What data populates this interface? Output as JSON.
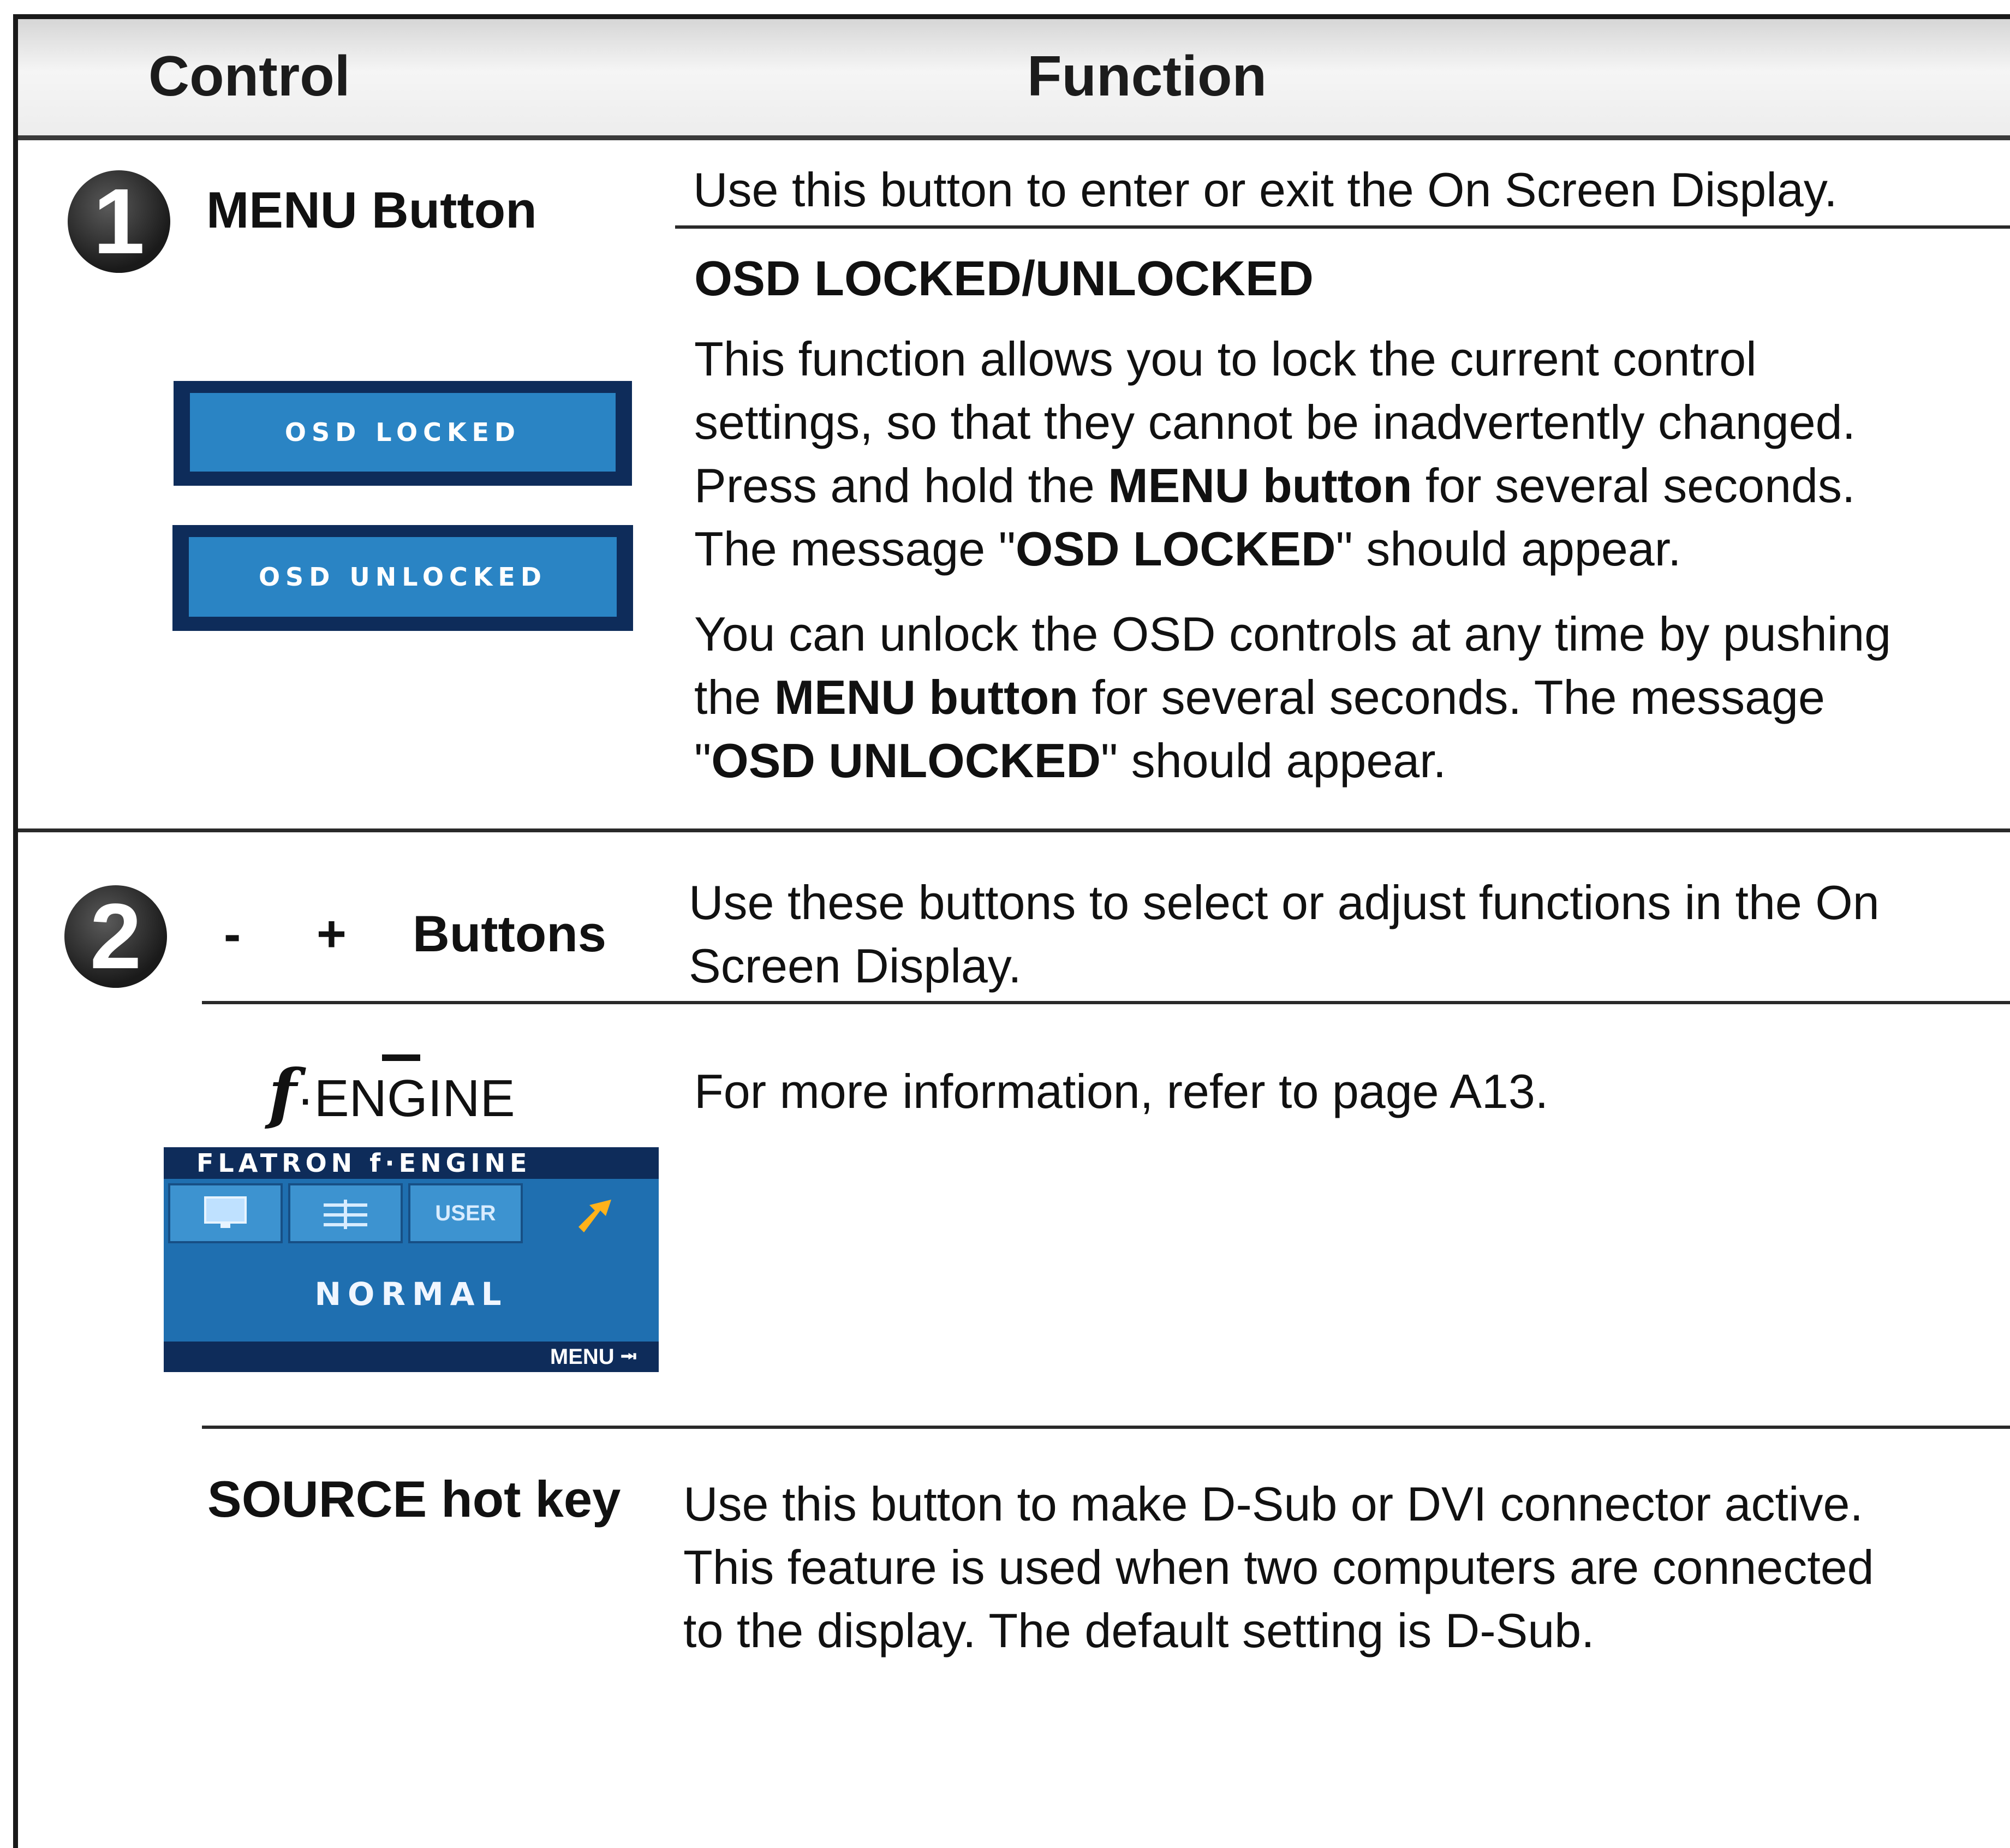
{
  "header": {
    "control": "Control",
    "function": "Function"
  },
  "row1": {
    "badge": "1",
    "label": "MENU Button",
    "intro": "Use this button to enter or exit the On Screen Display.",
    "subtitle": "OSD LOCKED/UNLOCKED",
    "para1": {
      "l1": "This function allows you to lock the current control",
      "l2": "settings, so that they cannot be inadvertently changed.",
      "l3a": "Press and hold the ",
      "l3b": "MENU button",
      "l3c": " for several seconds.",
      "l4a": "The message \"",
      "l4b": "OSD LOCKED",
      "l4c": "\" should appear."
    },
    "para2": {
      "l1": "You can unlock the OSD controls at any time by pushing",
      "l2a": "the ",
      "l2b": "MENU button",
      "l2c": " for several seconds. The message",
      "l3a": "\"",
      "l3b": "OSD UNLOCKED",
      "l3c": "\" should appear."
    },
    "osd_locked": "OSD LOCKED",
    "osd_unlocked": "OSD UNLOCKED",
    "colors": {
      "osd_dark": "#0e2c5a",
      "osd_blue": "#2a84c4"
    }
  },
  "row2": {
    "badge": "2",
    "minus": "-",
    "plus": "+",
    "label": "Buttons",
    "desc_l1": "Use these buttons to select or adjust functions in the On",
    "desc_l2": "Screen Display.",
    "fengine": {
      "f_glyph": "f",
      "dot": "·",
      "engine": "ENGINE",
      "osd_header": "FLATRON  f·ENGINE",
      "tile_user": "USER",
      "mode": "NORMAL",
      "menu": "MENU",
      "icons": [
        "monitor-icon",
        "grid-icon",
        "user-tile",
        "sparkle-icon"
      ]
    },
    "fengine_desc": "For more information, refer to page A13.",
    "source_label": "SOURCE hot key",
    "source_l1": "Use this button to make D-Sub or DVI connector active.",
    "source_l2": "This feature is used when two computers are connected",
    "source_l3": "to the display. The default setting is D-Sub."
  }
}
